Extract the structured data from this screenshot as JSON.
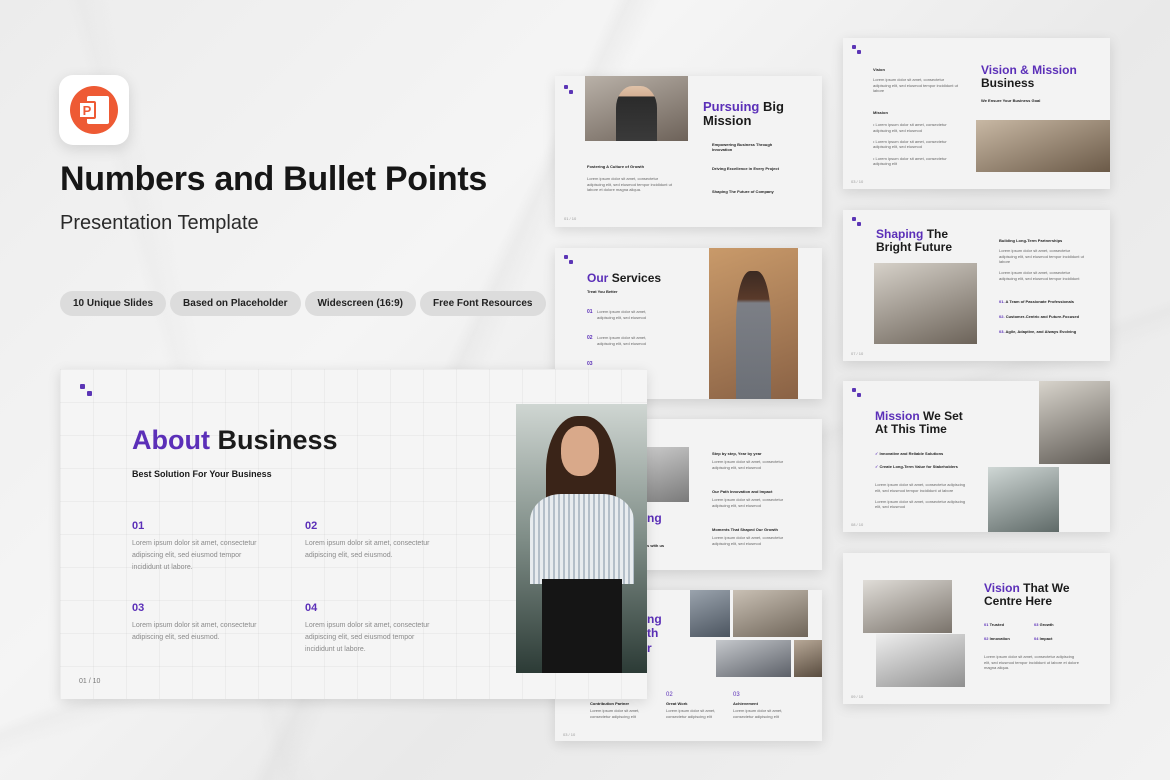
{
  "header": {
    "title": "Numbers and Bullet Points",
    "subtitle": "Presentation Template",
    "app_icon": "powerpoint-icon",
    "app_icon_letter": "P",
    "accent": "#5b2fb8",
    "icon_color": "#ee5a34"
  },
  "features": [
    "10 Unique Slides",
    "Based on Placeholder",
    "Widescreen (16:9)",
    "Free Font Resources"
  ],
  "about": {
    "title_accent": "About",
    "title_rest": "Business",
    "subtitle": "Best Solution For Your Business",
    "items": [
      {
        "num": "01",
        "text": "Lorem ipsum dolor sit amet, consectetur adipiscing elit, sed eiusmod tempor incididunt ut labore."
      },
      {
        "num": "02",
        "text": "Lorem ipsum dolor sit amet, consectetur adipiscing elit, sed eiusmod."
      },
      {
        "num": "03",
        "text": "Lorem ipsum dolor sit amet, consectetur adipiscing elit, sed eiusmod."
      },
      {
        "num": "04",
        "text": "Lorem ipsum dolor sit amet, consectetur adipiscing elit, sed eiusmod tempor incididunt ut labore."
      }
    ],
    "page": "01 / 10"
  },
  "pursuing": {
    "accent": "Pursuing",
    "rest": "Big",
    "line2": "Mission",
    "left_heading": "Fostering A Culture of Growth",
    "bullets": [
      "Empowering Business Through Innovation",
      "Driving Excellence in Every Project",
      "Shaping The Future of Company"
    ],
    "page": "01 / 10"
  },
  "services": {
    "accent": "Our",
    "rest": "Services",
    "sub": "Treat You Better",
    "nums": [
      "01",
      "02",
      "03"
    ]
  },
  "steps": {
    "items": [
      "Step by step, Year by year",
      "Our Path Innovation and Impact",
      "Moments That Shaped Our Growth"
    ],
    "partial_title": "ng",
    "partial_sub": "s with us"
  },
  "team": {
    "partial_title": [
      "ng",
      "th",
      "r"
    ],
    "cols": [
      {
        "num": "01",
        "label": "Contribution Partner"
      },
      {
        "num": "02",
        "label": "Great Work"
      },
      {
        "num": "03",
        "label": "Achievement"
      }
    ],
    "page": "03 / 10"
  },
  "vision_mission": {
    "accent": "Vision & Mission",
    "line2": "Business",
    "sub": "We Ensure Your Business Goal",
    "left_labels": [
      "Vision",
      "Mission"
    ],
    "page": "03 / 10"
  },
  "shaping": {
    "accent": "Shaping",
    "rest": "The",
    "line2": "Bright Future",
    "right_heading": "Building Long-Term Partnerships",
    "items": [
      {
        "num": "01.",
        "text": "A Team of Passionate Professionals"
      },
      {
        "num": "02.",
        "text": "Customer-Centric and Future-Focused"
      },
      {
        "num": "03.",
        "text": "Agile, Adaptive, and Always Evolving"
      }
    ],
    "page": "07 / 10"
  },
  "mission_time": {
    "accent": "Mission",
    "rest": "We Set",
    "line2": "At This Time",
    "checks": [
      "Innovative and Reliable Solutions",
      "Create Long-Term Value for Stakeholders"
    ],
    "page": "08 / 10"
  },
  "vision_centre": {
    "accent": "Vision",
    "rest": "That We",
    "line2": "Centre Here",
    "items": [
      {
        "num": "01",
        "text": "Trusted"
      },
      {
        "num": "03",
        "text": "Growth"
      },
      {
        "num": "02",
        "text": "Innovation"
      },
      {
        "num": "04",
        "text": "Impact"
      }
    ],
    "page": "09 / 10"
  }
}
